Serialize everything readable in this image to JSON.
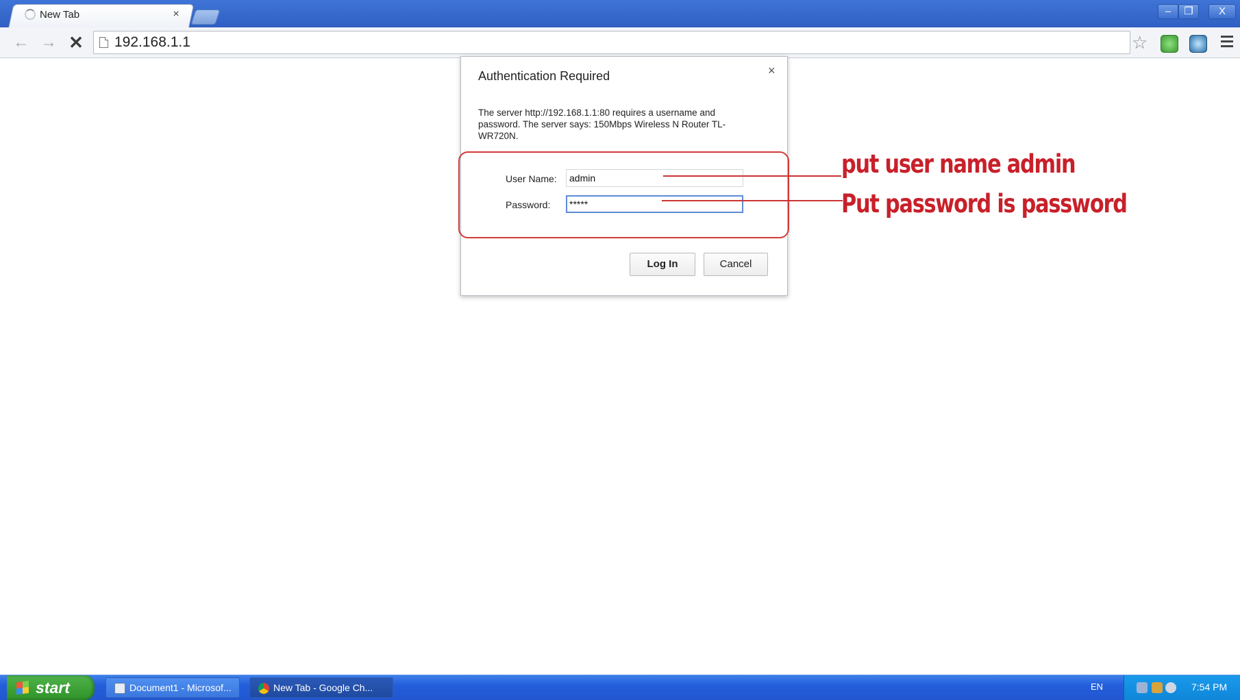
{
  "browser": {
    "tab": {
      "title": "New Tab",
      "close_glyph": "×"
    },
    "window_controls": {
      "minimize": "–",
      "maximize": "❐",
      "close": "X"
    },
    "toolbar": {
      "back_glyph": "←",
      "forward_glyph": "→",
      "stop_glyph": "✕",
      "url": "192.168.1.1",
      "star_glyph": "☆"
    }
  },
  "dialog": {
    "title": "Authentication Required",
    "close_glyph": "×",
    "message": "The server http://192.168.1.1:80 requires a username and password. The server says: 150Mbps Wireless N Router TL-WR720N.",
    "username_label": "User Name:",
    "username_value": "admin",
    "password_label": "Password:",
    "password_value": "*****",
    "login_label": "Log In",
    "cancel_label": "Cancel"
  },
  "annotations": {
    "line1": "put user name admin",
    "line2": "Put password is password",
    "color": "#c8202a"
  },
  "taskbar": {
    "start_label": "start",
    "tasks": [
      {
        "label": "Document1 - Microsof...",
        "icon": "word-document-icon"
      },
      {
        "label": "New Tab - Google Ch...",
        "icon": "chrome-icon"
      }
    ],
    "language": "EN",
    "clock": "7:54 PM"
  }
}
